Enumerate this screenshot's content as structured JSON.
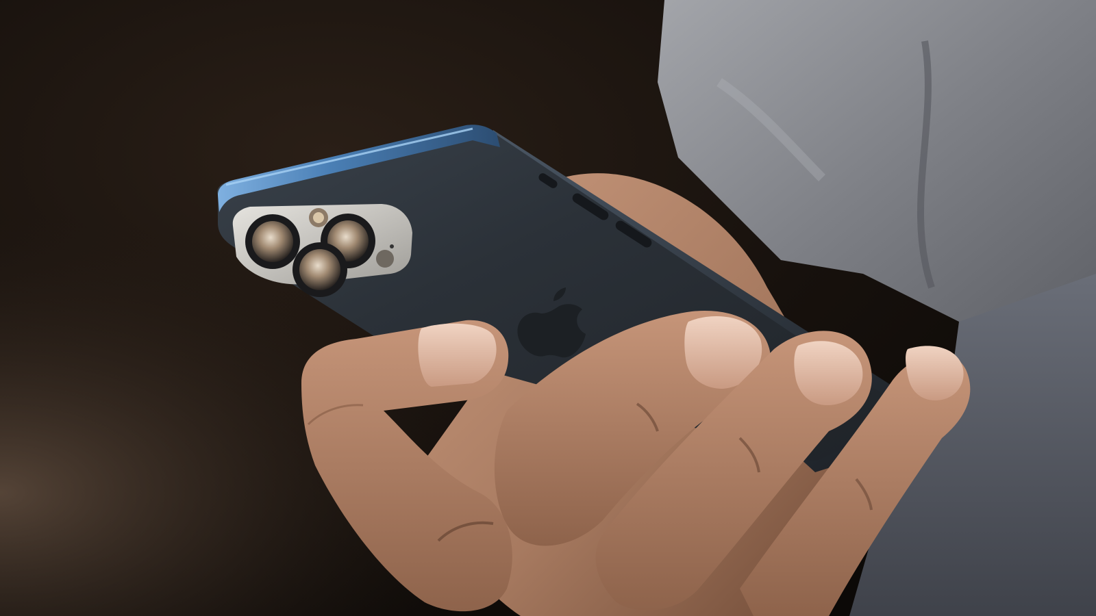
{
  "scene": {
    "subject": "hand-holding-phone",
    "colors": {
      "background_dark": "#120e0b",
      "background_warm": "#2a1f17",
      "phone_back": "#2b3138",
      "phone_frame_blue": "#4a7fb5",
      "camera_bump": "#c9c7c2",
      "lens": "#8c7a67",
      "skin": "#b98a6f",
      "skin_shadow": "#6f4a36",
      "nail": "#e3bda7",
      "sleeve": "#8b8d92",
      "shirt": "#5c606a"
    },
    "icons": [
      "apple-logo-icon",
      "camera-lens-icon",
      "flash-icon",
      "lidar-icon"
    ]
  }
}
